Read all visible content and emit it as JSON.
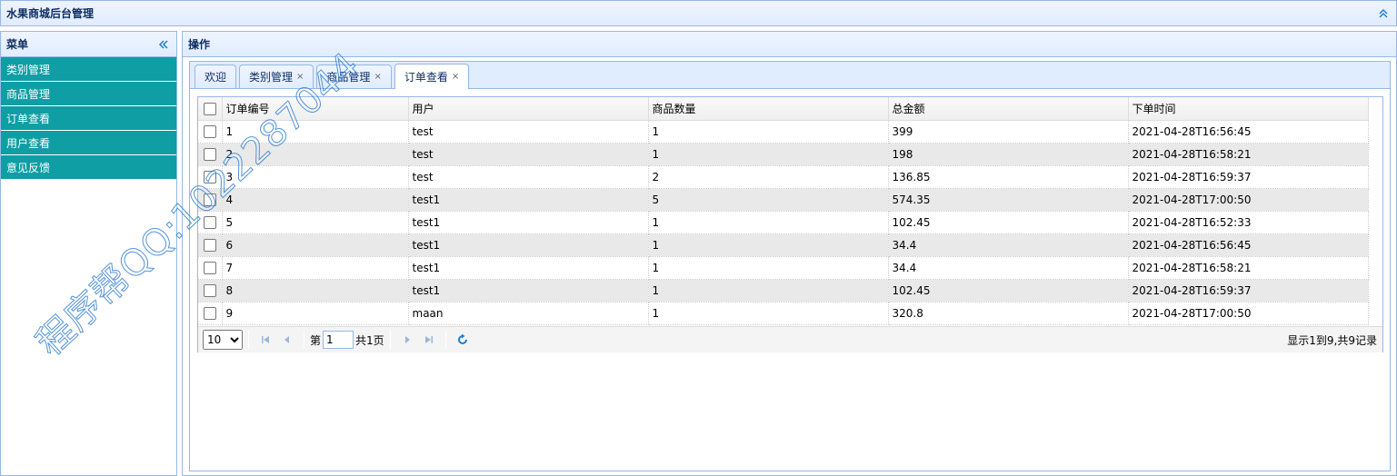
{
  "app": {
    "title": "水果商城后台管理"
  },
  "west": {
    "title": "菜单",
    "items": [
      {
        "label": "类别管理"
      },
      {
        "label": "商品管理"
      },
      {
        "label": "订单查看"
      },
      {
        "label": "用户查看"
      },
      {
        "label": "意见反馈"
      }
    ]
  },
  "center": {
    "title": "操作",
    "tabs": [
      {
        "label": "欢迎",
        "closable": false
      },
      {
        "label": "类别管理",
        "closable": true
      },
      {
        "label": "商品管理",
        "closable": true
      },
      {
        "label": "订单查看",
        "closable": true,
        "selected": true
      }
    ],
    "close_glyph": "×"
  },
  "grid": {
    "columns": [
      "订单编号",
      "用户",
      "商品数量",
      "总金额",
      "下单时间"
    ],
    "rows": [
      [
        "1",
        "test",
        "1",
        "399",
        "2021-04-28T16:56:45"
      ],
      [
        "2",
        "test",
        "1",
        "198",
        "2021-04-28T16:58:21"
      ],
      [
        "3",
        "test",
        "2",
        "136.85",
        "2021-04-28T16:59:37"
      ],
      [
        "4",
        "test1",
        "5",
        "574.35",
        "2021-04-28T17:00:50"
      ],
      [
        "5",
        "test1",
        "1",
        "102.45",
        "2021-04-28T16:52:33"
      ],
      [
        "6",
        "test1",
        "1",
        "34.4",
        "2021-04-28T16:56:45"
      ],
      [
        "7",
        "test1",
        "1",
        "34.4",
        "2021-04-28T16:58:21"
      ],
      [
        "8",
        "test1",
        "1",
        "102.45",
        "2021-04-28T16:59:37"
      ],
      [
        "9",
        "maan",
        "1",
        "320.8",
        "2021-04-28T17:00:50"
      ]
    ]
  },
  "pager": {
    "page_size": "10",
    "page_size_options": [
      "10"
    ],
    "page_prefix": "第",
    "page_value": "1",
    "page_total": "共1页",
    "info": "显示1到9,共9记录"
  },
  "watermark": {
    "text": "程序帮QQ:1022287044"
  },
  "colors": {
    "menu_bg": "#0e9ea4",
    "border": "#95b8e7",
    "header_bg": "#e0ecff",
    "icon": "#1e7fd0"
  }
}
